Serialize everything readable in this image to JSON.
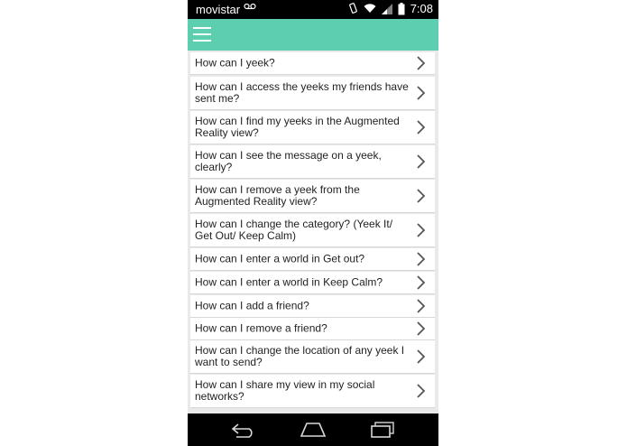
{
  "status_bar": {
    "carrier": "movistar",
    "voicemail_icon": "voicemail-icon",
    "time": "7:08"
  },
  "app_bar": {
    "menu_icon": "hamburger-menu-icon",
    "accent_color": "#5dcfb0"
  },
  "faq": {
    "items": [
      {
        "label": "How can I yeek?"
      },
      {
        "label": "How can I access the yeeks my friends have sent me?"
      },
      {
        "label": "How can I find my yeeks in the Augmented Reality view?"
      },
      {
        "label": "How can I see the message on a yeek, clearly?"
      },
      {
        "label": "How can I remove a yeek from the Augmented Reality view?"
      },
      {
        "label": "How can I change the category? (Yeek It/ Get Out/ Keep Calm)"
      },
      {
        "label": "How can I enter a world in Get out?"
      },
      {
        "label": "How can I enter a world in Keep Calm?"
      },
      {
        "label": "How can I add a friend?"
      },
      {
        "label": "How can I remove a friend?"
      },
      {
        "label": "How can I change the location of any yeek I want to send?"
      },
      {
        "label": "How can I share my view in my social networks?"
      }
    ]
  },
  "nav_bar": {
    "back_icon": "back-icon",
    "home_icon": "home-icon",
    "recents_icon": "recents-icon"
  }
}
